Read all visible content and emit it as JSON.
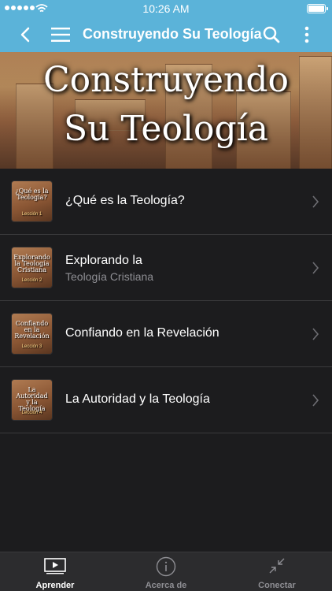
{
  "status_bar": {
    "time": "10:26 AM"
  },
  "nav": {
    "title": "Construyendo Su Teología"
  },
  "banner": {
    "line1": "Construyendo",
    "line2": "Su Teología"
  },
  "lessons": [
    {
      "thumb_title": "¿Qué es la Teología?",
      "thumb_label": "Lección 1",
      "title": "¿Qué es la Teología?",
      "subtitle": ""
    },
    {
      "thumb_title": "Explorando la Teología Cristiana",
      "thumb_label": "Lección 2",
      "title": "Explorando la",
      "subtitle": "Teología Cristiana"
    },
    {
      "thumb_title": "Confiando en la Revelación",
      "thumb_label": "Lección 3",
      "title": "Confiando en la Revelación",
      "subtitle": ""
    },
    {
      "thumb_title": "La Autoridad y la Teología",
      "thumb_label": "Lección 4",
      "title": "La Autoridad y la Teología",
      "subtitle": ""
    }
  ],
  "tabs": [
    {
      "label": "Aprender",
      "icon": "play-video-icon",
      "active": true
    },
    {
      "label": "Acerca de",
      "icon": "info-icon",
      "active": false
    },
    {
      "label": "Conectar",
      "icon": "collapse-arrows-icon",
      "active": false
    }
  ],
  "colors": {
    "nav_bg": "#5bb3d9",
    "background": "#1c1c1e",
    "tab_active": "#ffffff",
    "tab_inactive": "#8e8e93"
  }
}
